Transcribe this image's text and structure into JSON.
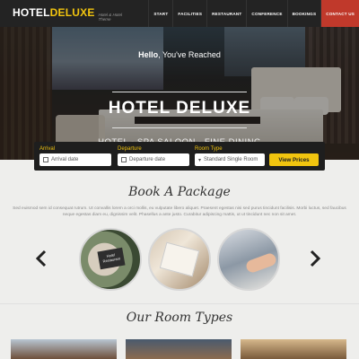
{
  "brand": {
    "name_part1": "HOTEL",
    "name_part2": "DELUXE",
    "tagline": "Hotel & Hotel Theme"
  },
  "nav": {
    "items": [
      {
        "label": "START",
        "active": false
      },
      {
        "label": "FACILITIES",
        "active": false
      },
      {
        "label": "RESTAURANT",
        "active": false
      },
      {
        "label": "CONFERENCE",
        "active": false
      },
      {
        "label": "BOOKINGS",
        "active": false
      },
      {
        "label": "CONTACT US",
        "active": true
      }
    ]
  },
  "hero": {
    "greeting_bold": "Hello",
    "greeting_rest": ", You've Reached",
    "title": "HOTEL DELUXE",
    "subtitle": "HOTEL - SPA SALOON - FINE DINING"
  },
  "booking": {
    "arrival_label": "Arrival",
    "arrival_placeholder": "Arrival date",
    "departure_label": "Departure",
    "departure_placeholder": "Departure date",
    "room_label": "Room Type",
    "room_value": "Standard Single Room",
    "button_label": "View Prices"
  },
  "packages": {
    "title": "Book A Package",
    "description": "Sed euismod sem id consequat rutrum. Ut convallis lorem a orci mollis, eu vulputate libero aliquet. Praesent egestas nisi sed purus tincidunt facilisis. Morbi luctus, sed faucibus neque egestas diam eu, dignissim velit. Phasellus a ante justo. Curabitur adipiscing mattis, ut ut tincidunt nec non sit amet.",
    "sign_text": "Hotel Restaurant"
  },
  "rooms": {
    "title": "Our Room Types"
  },
  "colors": {
    "accent": "#f1c40f",
    "nav_active": "#c0392b",
    "topbar": "#232323"
  }
}
